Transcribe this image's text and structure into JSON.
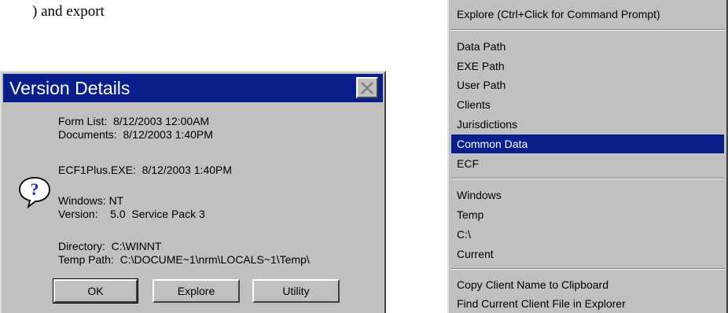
{
  "fragment_text": ") and export",
  "dialog": {
    "title": "Version Details",
    "lines": {
      "form_list": "Form List:  8/12/2003 12:00AM",
      "documents": "Documents:  8/12/2003 1:40PM",
      "exe": "ECF1Plus.EXE:  8/12/2003 1:40PM",
      "windows": "Windows: NT",
      "version": "Version:    5.0  Service Pack 3",
      "directory": "Directory:  C:\\WINNT",
      "temp_path": "Temp Path:  C:\\DOCUME~1\\nrm\\LOCALS~1\\Temp\\"
    },
    "buttons": {
      "ok": "OK",
      "explore": "Explore",
      "utility": "Utility"
    }
  },
  "menu": {
    "selected": "Common Data",
    "items": [
      "Explore (Ctrl+Click for Command Prompt)",
      "Data Path",
      "EXE Path",
      "User Path",
      "Clients",
      "Jurisdictions",
      "Common Data",
      "ECF",
      "Windows",
      "Temp",
      "C:\\",
      "Current",
      "Copy Client Name to Clipboard",
      "Find Current Client File in Explorer"
    ]
  },
  "colors": {
    "titlebar": "#0a1e8c",
    "face": "#c0c0c0",
    "highlight": "#0a1e8c"
  },
  "icons": {
    "dialog_icon": "question-icon",
    "close": "close-icon"
  }
}
